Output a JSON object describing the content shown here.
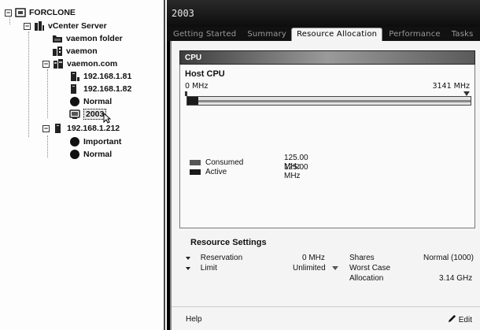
{
  "tree": {
    "root_label": "FORCLONE",
    "items": [
      {
        "label": "vCenter Server"
      },
      {
        "label": "vaemon folder"
      },
      {
        "label": "vaemon"
      },
      {
        "label": "vaemon.com"
      },
      {
        "label": "192.168.1.81"
      },
      {
        "label": "192.168.1.82"
      },
      {
        "label": "Normal"
      },
      {
        "label": "2003"
      },
      {
        "label": "192.168.1.212"
      },
      {
        "label": "Important"
      },
      {
        "label": "Normal"
      }
    ]
  },
  "main": {
    "title": "2003",
    "tabs": [
      {
        "label": "Getting Started"
      },
      {
        "label": "Summary"
      },
      {
        "label": "Resource Allocation"
      },
      {
        "label": "Performance"
      },
      {
        "label": "Tasks"
      }
    ],
    "active_tab_index": 2
  },
  "cpu": {
    "section_title": "CPU",
    "host_cpu_title": "Host CPU",
    "min_label": "0 MHz",
    "max_label": "3141 MHz",
    "max_mhz": 3141,
    "consumed_mhz": 125,
    "legend": [
      {
        "label": "Consumed",
        "value": "125.00 MHz",
        "color": "#555555"
      },
      {
        "label": "Active",
        "value": "125.00 MHz",
        "color": "#1a1a1a"
      }
    ]
  },
  "resource_settings": {
    "title": "Resource Settings",
    "reservation_label": "Reservation",
    "reservation_value": "0 MHz",
    "limit_label": "Limit",
    "limit_value": "Unlimited",
    "shares_label": "Shares",
    "shares_value": "Normal (1000)",
    "worst_case_label_1": "Worst Case",
    "worst_case_label_2": "Allocation",
    "worst_case_value": "3.14 GHz"
  },
  "footer": {
    "help_label": "Help",
    "edit_label": "Edit"
  }
}
